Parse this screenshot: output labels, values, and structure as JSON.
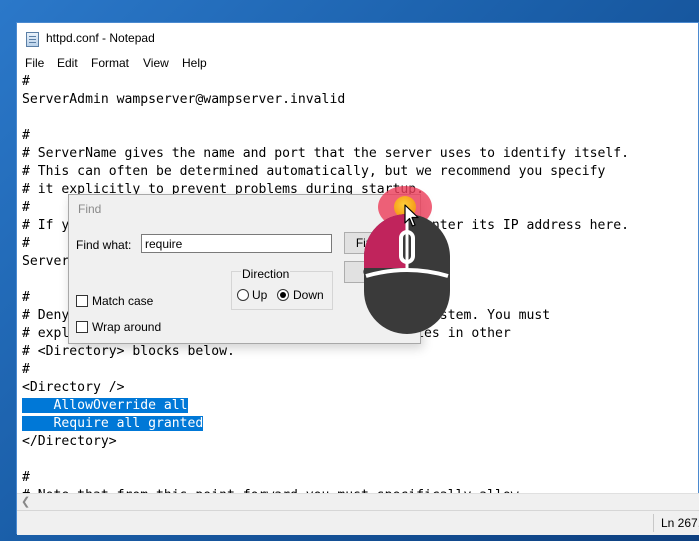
{
  "window": {
    "title": "httpd.conf - Notepad",
    "icon": "notepad-icon"
  },
  "menu": [
    "File",
    "Edit",
    "Format",
    "View",
    "Help"
  ],
  "editor": {
    "lines": [
      {
        "text": "#",
        "selected": false
      },
      {
        "text": "ServerAdmin wampserver@wampserver.invalid",
        "selected": false
      },
      {
        "text": "",
        "selected": false
      },
      {
        "text": "#",
        "selected": false
      },
      {
        "text": "# ServerName gives the name and port that the server uses to identify itself.",
        "selected": false
      },
      {
        "text": "# This can often be determined automatically, but we recommend you specify",
        "selected": false
      },
      {
        "text": "# it explicitly to prevent problems during startup.",
        "selected": false
      },
      {
        "text": "#",
        "selected": false
      },
      {
        "text": "# If your host doesn't have a registered DNS name, enter its IP address here.",
        "selected": false
      },
      {
        "text": "#",
        "selected": false
      },
      {
        "text": "ServerName localhost:80",
        "selected": false
      },
      {
        "text": "",
        "selected": false
      },
      {
        "text": "#",
        "selected": false
      },
      {
        "text": "# Deny access to the entirety of your server's filesystem. You must",
        "selected": false
      },
      {
        "text": "# explicitly permit access to web content directories in other",
        "selected": false
      },
      {
        "text": "# <Directory> blocks below.",
        "selected": false
      },
      {
        "text": "#",
        "selected": false
      },
      {
        "text": "<Directory />",
        "selected": false
      },
      {
        "text": "    AllowOverride all",
        "selected": true
      },
      {
        "text": "    Require all granted",
        "selected": true
      },
      {
        "text": "</Directory>",
        "selected": false
      },
      {
        "text": "",
        "selected": false
      },
      {
        "text": "#",
        "selected": false
      },
      {
        "text": "# Note that from this point forward you must specifically allow",
        "selected": false
      }
    ]
  },
  "status": {
    "position": "Ln 267,"
  },
  "find_dialog": {
    "title": "Find",
    "find_what_label": "Find what:",
    "find_what_value": "require",
    "find_next_label": "Find Next",
    "cancel_label": "Cancel",
    "direction_label": "Direction",
    "up_label": "Up",
    "down_label": "Down",
    "selected_direction": "Down",
    "match_case_label": "Match case",
    "match_case_checked": false,
    "wrap_around_label": "Wrap around",
    "wrap_around_checked": false
  },
  "overlay": {
    "click_indicator": "click-highlight-icon",
    "mouse": "mouse-left-click-icon",
    "pointer": "arrow-cursor-icon"
  },
  "colors": {
    "selection": "#0078d7",
    "desktop": "#1a5ea8",
    "mouse_body": "#3a3a3a",
    "mouse_left_button": "#c0245c",
    "click_ring": "#ec405c",
    "click_dot": "#f6a21b"
  }
}
